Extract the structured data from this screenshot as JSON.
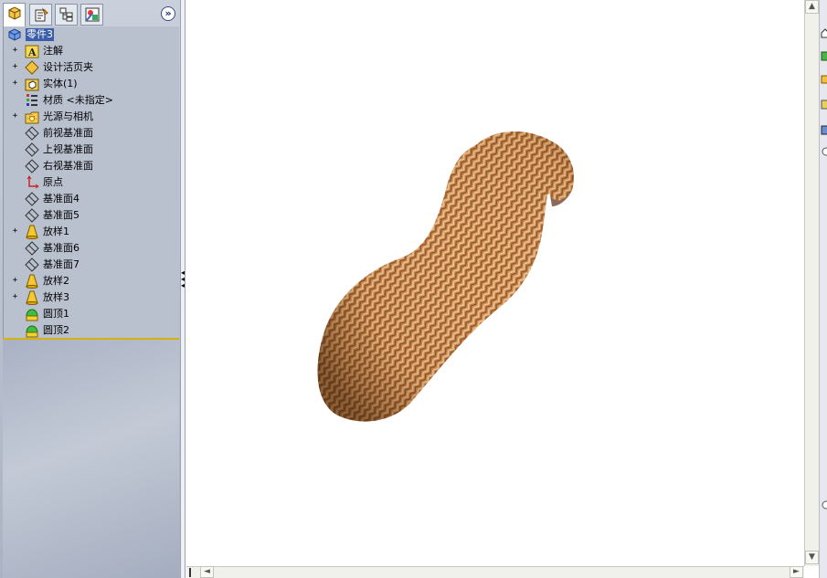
{
  "panel": {
    "tabs": [
      {
        "name": "feature-manager",
        "icon": "feature-tree-icon"
      },
      {
        "name": "property-manager",
        "icon": "property-icon"
      },
      {
        "name": "configuration-manager",
        "icon": "configuration-icon"
      },
      {
        "name": "display-manager",
        "icon": "appearance-icon"
      }
    ],
    "expand_glyph": "»",
    "tree": {
      "root": {
        "label": "零件3",
        "icon": "part-icon"
      },
      "items": [
        {
          "label": "注解",
          "icon": "annotation-icon",
          "expandable": true
        },
        {
          "label": "设计活页夹",
          "icon": "design-binder-icon",
          "expandable": true
        },
        {
          "label": "实体(1)",
          "icon": "solid-body-icon",
          "expandable": true
        },
        {
          "label": "材质 <未指定>",
          "icon": "material-icon",
          "expandable": false
        },
        {
          "label": "光源与相机",
          "icon": "lights-cameras-icon",
          "expandable": true
        },
        {
          "label": "前视基准面",
          "icon": "plane-icon",
          "expandable": false
        },
        {
          "label": "上视基准面",
          "icon": "plane-icon",
          "expandable": false
        },
        {
          "label": "右视基准面",
          "icon": "plane-icon",
          "expandable": false
        },
        {
          "label": "原点",
          "icon": "origin-icon",
          "expandable": false
        },
        {
          "label": "基准面4",
          "icon": "plane-icon",
          "expandable": false
        },
        {
          "label": "基准面5",
          "icon": "plane-icon",
          "expandable": false
        },
        {
          "label": "放样1",
          "icon": "loft-icon",
          "expandable": true
        },
        {
          "label": "基准面6",
          "icon": "plane-icon",
          "expandable": false
        },
        {
          "label": "基准面7",
          "icon": "plane-icon",
          "expandable": false
        },
        {
          "label": "放样2",
          "icon": "loft-icon",
          "expandable": true
        },
        {
          "label": "放样3",
          "icon": "loft-icon",
          "expandable": true
        },
        {
          "label": "圆顶1",
          "icon": "dome-icon",
          "expandable": false
        },
        {
          "label": "圆顶2",
          "icon": "dome-icon",
          "expandable": false
        }
      ]
    }
  },
  "viewport": {
    "model_name": "peanut-shell-model",
    "colors": {
      "shell_base": "#c8834a",
      "shell_dark": "#7a3e1a",
      "shell_light": "#f0c894"
    }
  },
  "scrollbars": {
    "up_glyph": "▲",
    "down_glyph": "▼",
    "left_glyph": "◄",
    "right_glyph": "►"
  }
}
